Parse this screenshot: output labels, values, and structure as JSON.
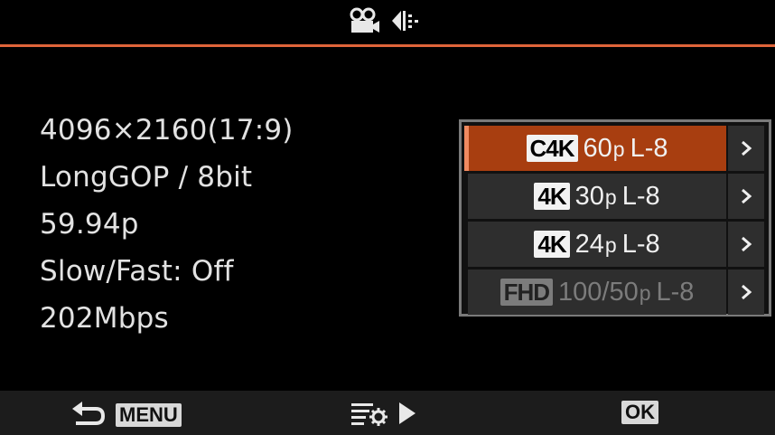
{
  "header": {
    "icons": [
      "movie-camera-icon",
      "image-stabilizer-icon"
    ]
  },
  "info": {
    "resolution": "4096×2160(17:9)",
    "codec": "LongGOP / 8bit",
    "frame_rate": "59.94p",
    "slow_fast": "Slow/Fast: Off",
    "bitrate": "202Mbps"
  },
  "options": [
    {
      "badge": "C4K",
      "rate": "60",
      "unit": "p",
      "suffix": "L-8",
      "selected": true
    },
    {
      "badge": "4K",
      "rate": "30",
      "unit": "p",
      "suffix": "L-8"
    },
    {
      "badge": "4K",
      "rate": "24",
      "unit": "p",
      "suffix": "L-8"
    },
    {
      "badge": "FHD",
      "rate": "100/50",
      "unit": "p",
      "suffix": "L-8",
      "disabled": true
    }
  ],
  "footer": {
    "menu_label": "MENU",
    "ok_label": "OK"
  },
  "colors": {
    "accent": "#e0643a",
    "selected_bg": "#a83e10"
  }
}
